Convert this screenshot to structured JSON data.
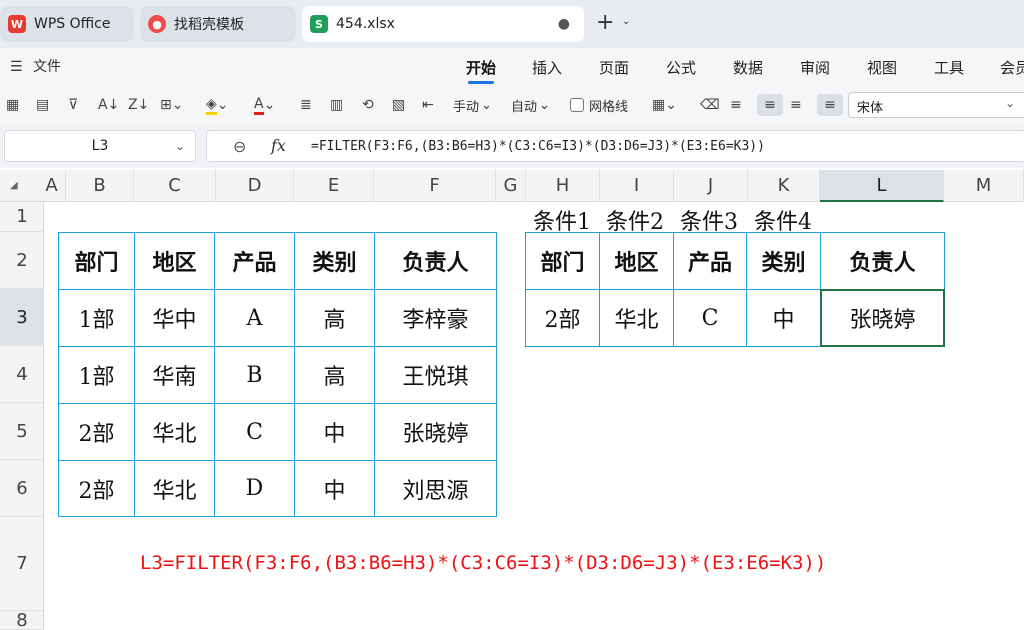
{
  "tabs": [
    {
      "label": "WPS Office",
      "icon": "wps-logo-icon"
    },
    {
      "label": "找稻壳模板",
      "icon": "docer-logo-icon"
    },
    {
      "label": "454.xlsx",
      "icon": "spreadsheet-s-icon",
      "close": "●"
    }
  ],
  "menu": {
    "file": "文件",
    "items": [
      "开始",
      "插入",
      "页面",
      "公式",
      "数据",
      "审阅",
      "视图",
      "工具",
      "会员"
    ],
    "active": "开始"
  },
  "toolbar": {
    "manual": "手动",
    "auto": "自动",
    "gridlines": "网格线",
    "font": "宋体"
  },
  "formula_bar": {
    "cell_ref": "L3",
    "formula": "=FILTER(F3:F6,(B3:B6=H3)*(C3:C6=I3)*(D3:D6=J3)*(E3:E6=K3))"
  },
  "columns": [
    "A",
    "B",
    "C",
    "D",
    "E",
    "F",
    "G",
    "H",
    "I",
    "J",
    "K",
    "L",
    "M"
  ],
  "selected_column": "L",
  "rows": [
    "1",
    "2",
    "3",
    "4",
    "5",
    "6",
    "7",
    "8"
  ],
  "selected_row": "3",
  "source_table": {
    "headers": [
      "部门",
      "地区",
      "产品",
      "类别",
      "负责人"
    ],
    "rows": [
      [
        "1部",
        "华中",
        "A",
        "高",
        "李梓豪"
      ],
      [
        "1部",
        "华南",
        "B",
        "高",
        "王悦琪"
      ],
      [
        "2部",
        "华北",
        "C",
        "中",
        "张晓婷"
      ],
      [
        "2部",
        "华北",
        "D",
        "中",
        "刘思源"
      ]
    ]
  },
  "conditions": [
    "条件1",
    "条件2",
    "条件3",
    "条件4"
  ],
  "query_table": {
    "headers": [
      "部门",
      "地区",
      "产品",
      "类别",
      "负责人"
    ],
    "row": [
      "2部",
      "华北",
      "C",
      "中",
      "张晓婷"
    ]
  },
  "note_formula": "L3=FILTER(F3:F6,(B3:B6=H3)*(C3:C6=I3)*(D3:D6=J3)*(E3:E6=K3))",
  "colors": {
    "accent": "#1a73e8",
    "table_border": "#1a9fd8",
    "selection": "#217346",
    "note": "#ee1111"
  }
}
